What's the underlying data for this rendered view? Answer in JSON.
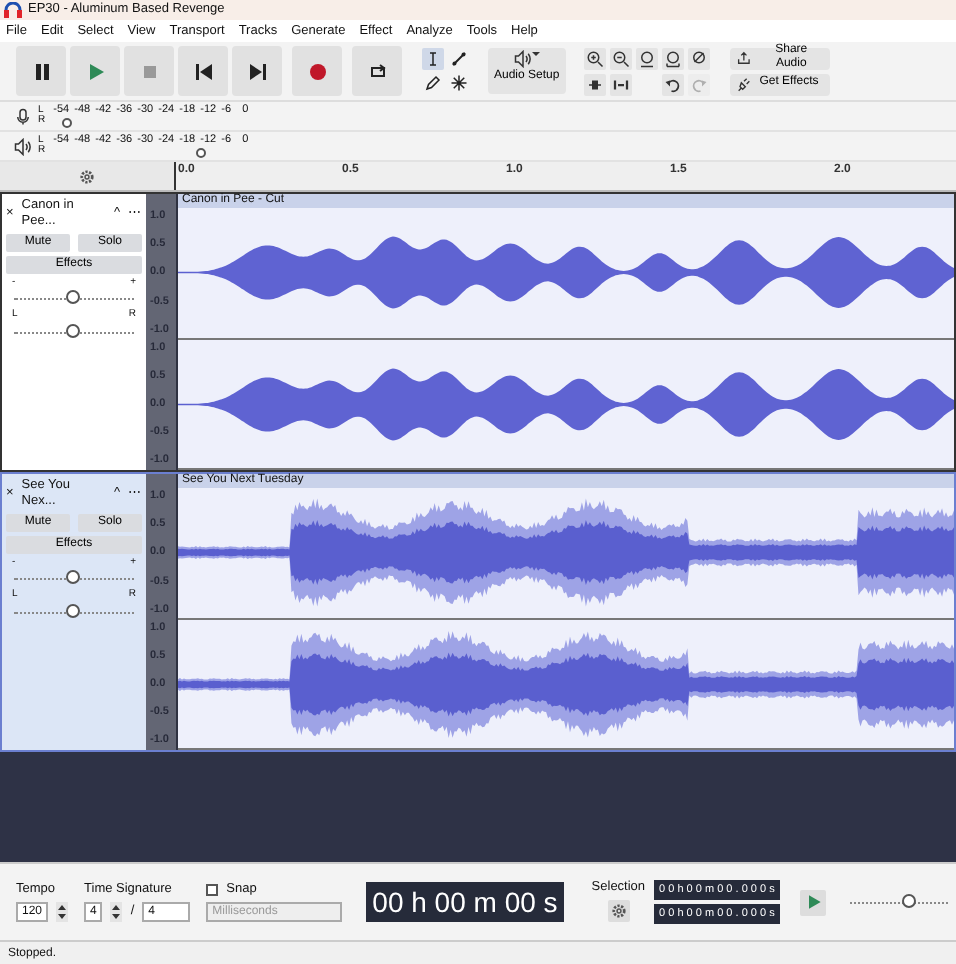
{
  "window": {
    "title": "EP30 - Aluminum Based Revenge"
  },
  "menu": [
    "File",
    "Edit",
    "Select",
    "View",
    "Transport",
    "Tracks",
    "Generate",
    "Effect",
    "Analyze",
    "Tools",
    "Help"
  ],
  "transport": [
    {
      "kind": "pause"
    },
    {
      "kind": "play"
    },
    {
      "kind": "stop"
    },
    {
      "kind": "skip-start"
    },
    {
      "kind": "skip-end"
    },
    {
      "kind": "record"
    },
    {
      "kind": "loop"
    }
  ],
  "tools": [
    {
      "kind": "select",
      "selected": true
    },
    {
      "kind": "envelope",
      "selected": false
    },
    {
      "kind": "draw",
      "selected": false
    },
    {
      "kind": "multi",
      "selected": false
    }
  ],
  "audio_setup": {
    "label": "Audio Setup"
  },
  "edit_tools": [
    {
      "kind": "zoom-in",
      "disabled": false
    },
    {
      "kind": "zoom-out",
      "disabled": false
    },
    {
      "kind": "fit-selection",
      "disabled": false
    },
    {
      "kind": "fit-project",
      "disabled": false
    },
    {
      "kind": "zoom-toggle",
      "disabled": false
    },
    {
      "kind": "trim",
      "disabled": false
    },
    {
      "kind": "silence",
      "disabled": false
    },
    {
      "kind": "undo",
      "disabled": false
    },
    {
      "kind": "redo",
      "disabled": true
    }
  ],
  "share_audio": "Share Audio",
  "get_effects": "Get Effects",
  "meters": [
    {
      "kind": "mic",
      "channels": [
        "L",
        "R"
      ],
      "scale": [
        "-54",
        "-48",
        "-42",
        "-36",
        "-30",
        "-24",
        "-18",
        "-12",
        "-6",
        "0"
      ],
      "level": 0.07
    },
    {
      "kind": "speaker",
      "channels": [
        "L",
        "R"
      ],
      "scale": [
        "-54",
        "-48",
        "-42",
        "-36",
        "-30",
        "-24",
        "-18",
        "-12",
        "-6",
        "0"
      ],
      "level": 0.74
    }
  ],
  "timeline": [
    "0.0",
    "0.5",
    "1.0",
    "1.5",
    "2.0"
  ],
  "tracks": [
    {
      "close": "×",
      "name": "Canon in Pee...",
      "collapse": "^",
      "more": "⋯",
      "clip": "Canon in Pee - Cut",
      "selected": false,
      "mute": "Mute",
      "solo": "Solo",
      "effects": "Effects",
      "gain": {
        "minus": "-",
        "plus": "+",
        "level": 0.5
      },
      "pan": {
        "left": "L",
        "right": "R",
        "level": 0.5
      },
      "kind": "clean",
      "channels": [
        {
          "scale": [
            "1.0",
            "0.5",
            "0.0",
            "-0.5",
            "-1.0"
          ]
        },
        {
          "scale": [
            "1.0",
            "0.5",
            "0.0",
            "-0.5",
            "-1.0"
          ]
        }
      ]
    },
    {
      "close": "×",
      "name": "See You Nex...",
      "collapse": "^",
      "more": "⋯",
      "clip": "See You Next Tuesday",
      "selected": true,
      "mute": "Mute",
      "solo": "Solo",
      "effects": "Effects",
      "gain": {
        "minus": "-",
        "plus": "+",
        "level": 0.5
      },
      "pan": {
        "left": "L",
        "right": "R",
        "level": 0.5
      },
      "kind": "dense",
      "channels": [
        {
          "scale": [
            "1.0",
            "0.5",
            "0.0",
            "-0.5",
            "-1.0"
          ]
        },
        {
          "scale": [
            "1.0",
            "0.5",
            "0.0",
            "-0.5",
            "-1.0"
          ]
        }
      ]
    }
  ],
  "bottom": {
    "tempo_label": "Tempo",
    "tempo": "120",
    "time_signature_label": "Time Signature",
    "beats": "4",
    "slash": "/",
    "beat_unit": "4",
    "snap": {
      "label": "Snap",
      "checked": false
    },
    "snap_unit": "Milliseconds",
    "time": "00 h 00 m 00 s",
    "selection_label": "Selection",
    "selection": [
      "0 0 h 0 0 m 0 0 . 0 0 0 s",
      "0 0 h 0 0 m 0 0 . 0 0 0 s"
    ],
    "speed": {
      "level": 0.6
    }
  },
  "status": "Stopped."
}
